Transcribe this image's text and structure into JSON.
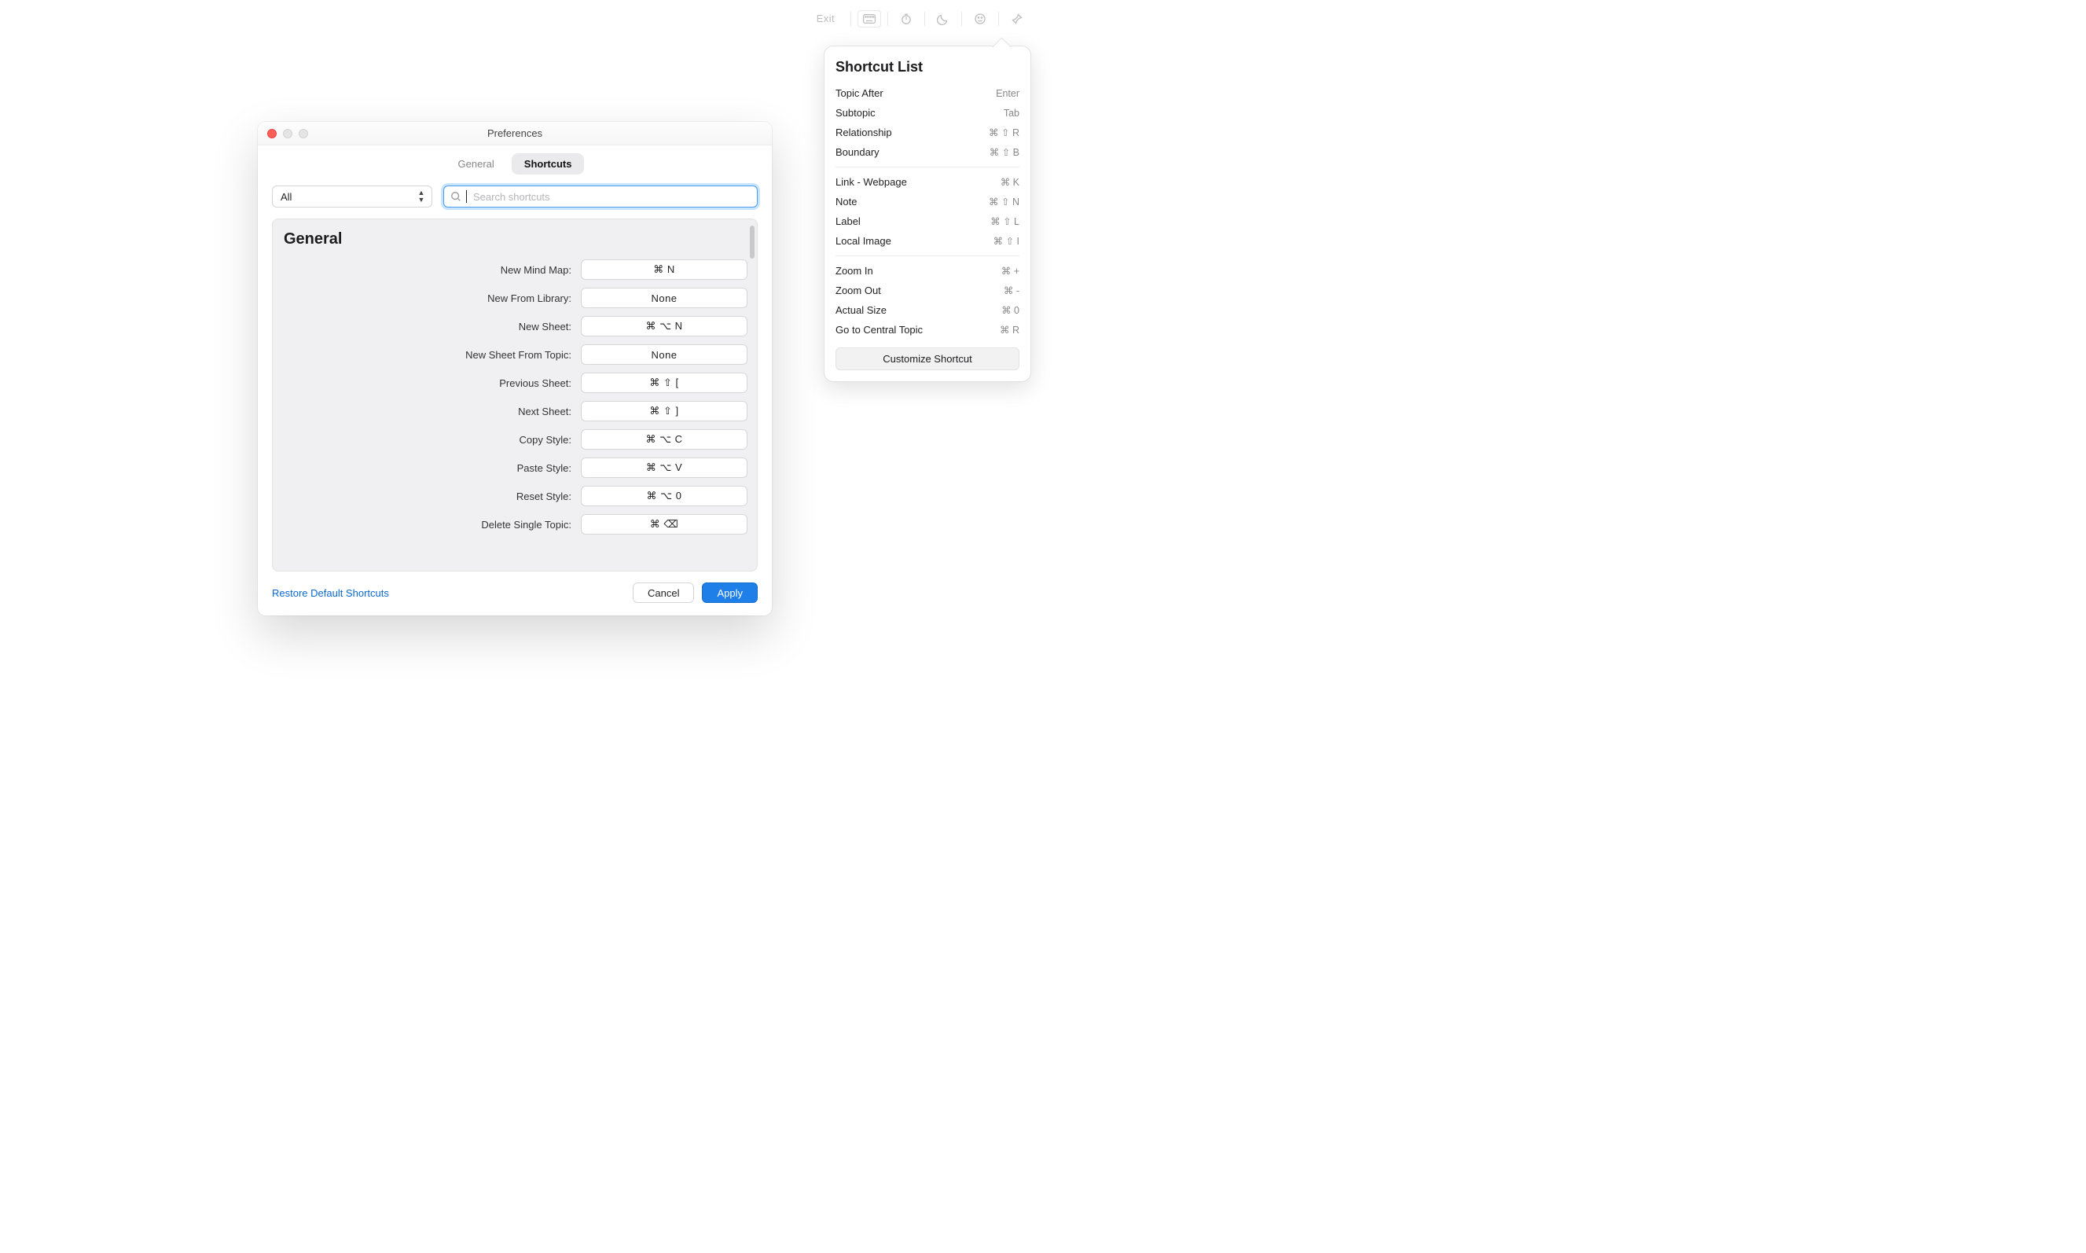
{
  "topbar": {
    "exit_label": "Exit"
  },
  "shortcutPopover": {
    "title": "Shortcut List",
    "customize_label": "Customize Shortcut",
    "groups": [
      {
        "items": [
          {
            "name": "Topic After",
            "keys": "Enter"
          },
          {
            "name": "Subtopic",
            "keys": "Tab"
          },
          {
            "name": "Relationship",
            "keys": "⌘ ⇧ R"
          },
          {
            "name": "Boundary",
            "keys": "⌘ ⇧ B"
          }
        ]
      },
      {
        "items": [
          {
            "name": "Link - Webpage",
            "keys": "⌘ K"
          },
          {
            "name": "Note",
            "keys": "⌘ ⇧ N"
          },
          {
            "name": "Label",
            "keys": "⌘ ⇧ L"
          },
          {
            "name": "Local Image",
            "keys": "⌘ ⇧ I"
          }
        ]
      },
      {
        "items": [
          {
            "name": "Zoom In",
            "keys": "⌘ +"
          },
          {
            "name": "Zoom Out",
            "keys": "⌘ -"
          },
          {
            "name": "Actual Size",
            "keys": "⌘ 0"
          },
          {
            "name": "Go to Central Topic",
            "keys": "⌘ R"
          }
        ]
      }
    ]
  },
  "prefs": {
    "title": "Preferences",
    "tabs": {
      "general": "General",
      "shortcuts": "Shortcuts"
    },
    "filter": {
      "all": "All"
    },
    "search": {
      "placeholder": "Search shortcuts"
    },
    "section_title": "General",
    "rows": [
      {
        "label": "New Mind Map:",
        "value": "⌘ N"
      },
      {
        "label": "New From Library:",
        "value": "None"
      },
      {
        "label": "New Sheet:",
        "value": "⌘ ⌥ N"
      },
      {
        "label": "New Sheet From Topic:",
        "value": "None"
      },
      {
        "label": "Previous Sheet:",
        "value": "⌘ ⇧ ["
      },
      {
        "label": "Next Sheet:",
        "value": "⌘ ⇧ ]"
      },
      {
        "label": "Copy Style:",
        "value": "⌘ ⌥ C"
      },
      {
        "label": "Paste Style:",
        "value": "⌘ ⌥ V"
      },
      {
        "label": "Reset Style:",
        "value": "⌘ ⌥ 0"
      },
      {
        "label": "Delete Single Topic:",
        "value": "⌘ ⌫"
      }
    ],
    "footer": {
      "restore": "Restore Default Shortcuts",
      "cancel": "Cancel",
      "apply": "Apply"
    }
  }
}
